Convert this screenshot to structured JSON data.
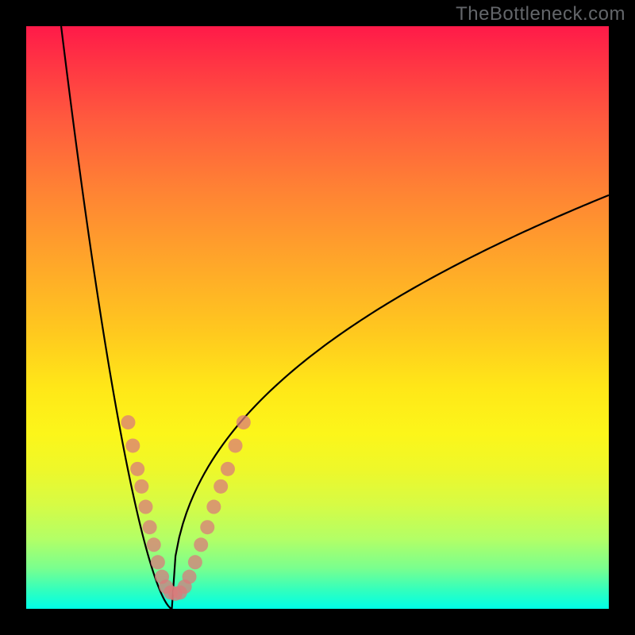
{
  "watermark": "TheBottleneck.com",
  "chart_data": {
    "type": "line",
    "title": "",
    "xlabel": "",
    "ylabel": "",
    "xlim": [
      0,
      100
    ],
    "ylim": [
      0,
      100
    ],
    "curve": {
      "left_top": {
        "x": 6,
        "y": 100
      },
      "minimum": {
        "x": 25,
        "y": 0
      },
      "right_end": {
        "x": 100,
        "y": 71
      },
      "description": "V-shaped bottleneck curve: steep descent from top-left to a narrow minimum around x≈25, then rising with diminishing slope toward upper right."
    },
    "marker_band": {
      "description": "Pink circular markers placed along both arms of the V roughly between y≈3 and y≈32.",
      "points": [
        {
          "x": 17.5,
          "y": 32
        },
        {
          "x": 18.3,
          "y": 28
        },
        {
          "x": 19.1,
          "y": 24
        },
        {
          "x": 19.8,
          "y": 21
        },
        {
          "x": 20.5,
          "y": 17.5
        },
        {
          "x": 21.2,
          "y": 14
        },
        {
          "x": 21.9,
          "y": 11
        },
        {
          "x": 22.6,
          "y": 8
        },
        {
          "x": 23.3,
          "y": 5.5
        },
        {
          "x": 24.0,
          "y": 3.8
        },
        {
          "x": 24.8,
          "y": 2.8
        },
        {
          "x": 25.6,
          "y": 2.6
        },
        {
          "x": 26.4,
          "y": 2.8
        },
        {
          "x": 27.2,
          "y": 3.8
        },
        {
          "x": 28.0,
          "y": 5.5
        },
        {
          "x": 29.0,
          "y": 8
        },
        {
          "x": 30.0,
          "y": 11
        },
        {
          "x": 31.1,
          "y": 14
        },
        {
          "x": 32.2,
          "y": 17.5
        },
        {
          "x": 33.4,
          "y": 21
        },
        {
          "x": 34.6,
          "y": 24
        },
        {
          "x": 35.9,
          "y": 28
        },
        {
          "x": 37.3,
          "y": 32
        }
      ]
    },
    "colors": {
      "curve": "#000000",
      "markers": "#d97b7b",
      "gradient_top": "#ff1a49",
      "gradient_bottom": "#00ffe7"
    }
  }
}
